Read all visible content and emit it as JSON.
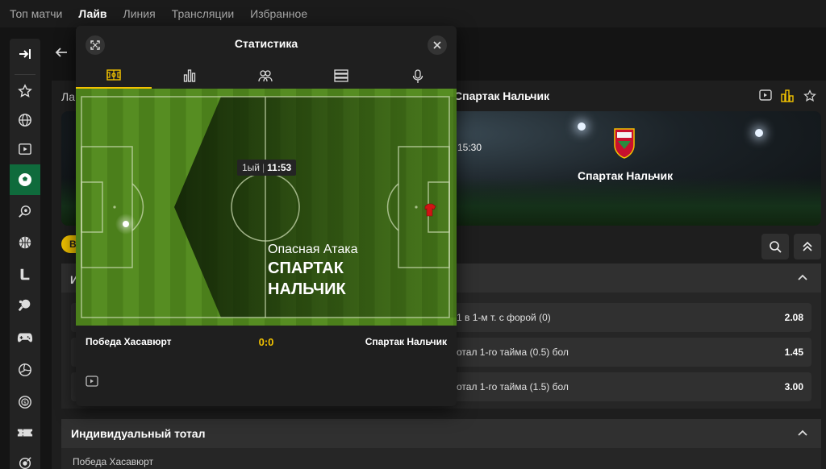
{
  "topnav": {
    "items": [
      "Топ матчи",
      "Лайв",
      "Линия",
      "Трансляции",
      "Избранное"
    ],
    "active": "Лайв"
  },
  "sidebar": {
    "icons": [
      "collapse-sidebar-icon",
      "star-icon",
      "globe-icon",
      "video-icon",
      "football-icon",
      "search-sport-icon",
      "basketball-icon",
      "hockey-icon",
      "table-tennis-icon",
      "esports-gamepad-icon",
      "volleyball-icon",
      "coin-icon",
      "ticket-icon",
      "target-icon"
    ],
    "active_icon": "football-icon",
    "accent": "#0f6b3c"
  },
  "match": {
    "breadcrumb_left": "Ла",
    "title": "Спартак Нальчик",
    "time": "15:30",
    "team_right": "Спартак Нальчик"
  },
  "pill_label": "В",
  "sections": {
    "first_head": "И",
    "individual_total": "Индивидуальный тотал",
    "team_sub": "Победа Хасавюрт"
  },
  "odds": [
    {
      "label": "1 в 1-м т. с форой (0)",
      "value": "2.08"
    },
    {
      "label": "отал 1-го тайма (0.5) бол",
      "value": "1.45"
    },
    {
      "label": "отал 1-го тайма (1.5) бол",
      "value": "3.00"
    }
  ],
  "modal": {
    "title": "Статистика",
    "tabs": [
      "pitch-tab-icon",
      "bar-chart-tab-icon",
      "lineups-tab-icon",
      "table-tab-icon",
      "microphone-tab-icon"
    ],
    "active_tab": 0,
    "clock": {
      "half": "1ый",
      "separator": "|",
      "time": "11:53"
    },
    "event": {
      "type": "Опасная Атака",
      "team": "СПАРТАК НАЛЬЧИК"
    },
    "home": "Победа Хасавюрт",
    "score": "0:0",
    "away": "Спартак Нальчик"
  },
  "colors": {
    "accent": "#f2c200",
    "pitch_dark": "#4b7f1b",
    "pitch_light": "#568d22",
    "background": "#141414"
  }
}
